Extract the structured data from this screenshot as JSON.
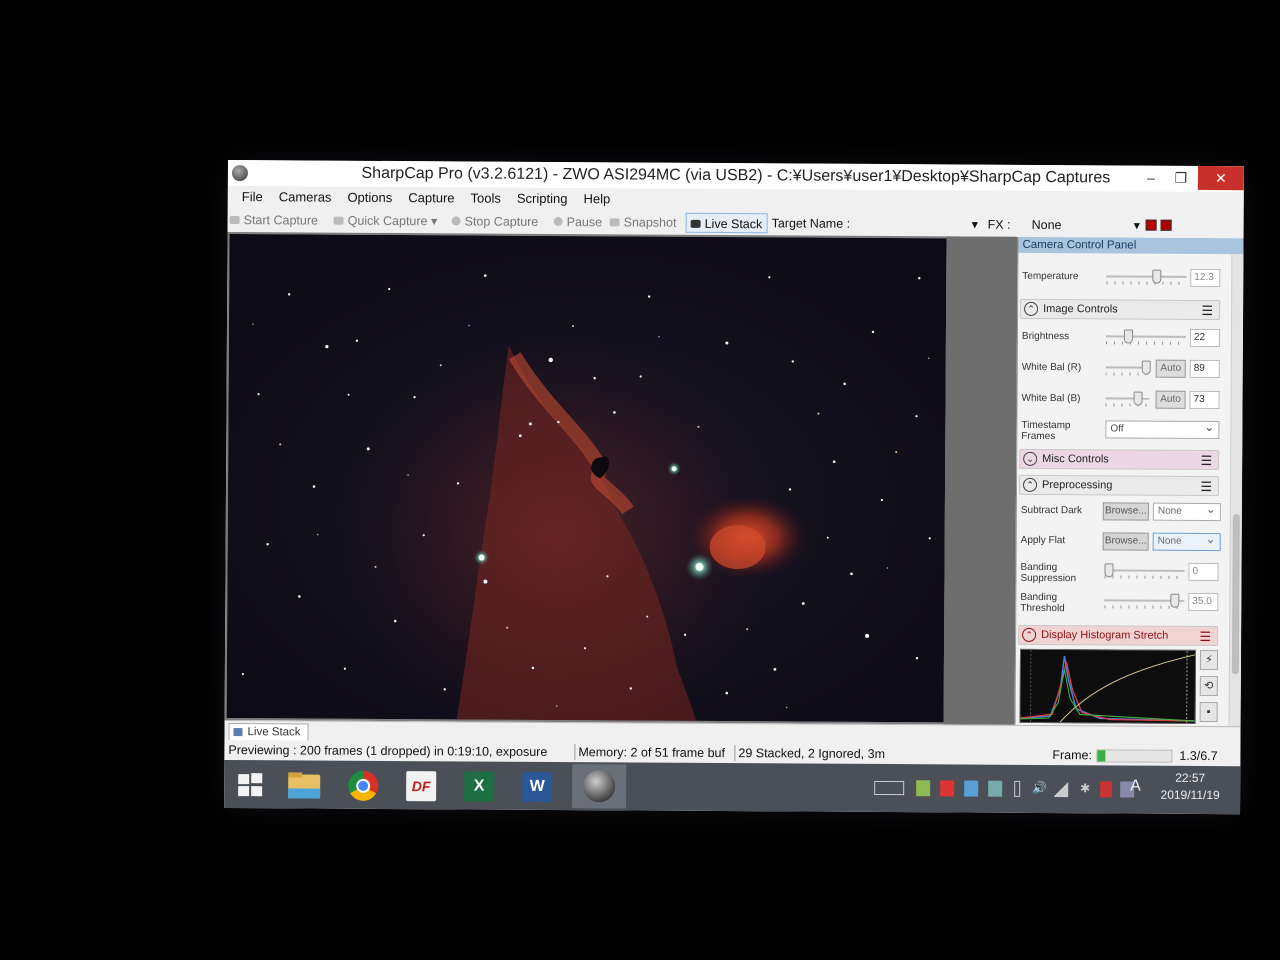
{
  "window": {
    "title": "SharpCap Pro (v3.2.6121) - ZWO ASI294MC (via USB2) - C:¥Users¥user1¥Desktop¥SharpCap Captures",
    "min": "–",
    "max": "❐",
    "close": "✕"
  },
  "menu": [
    "File",
    "Cameras",
    "Options",
    "Capture",
    "Tools",
    "Scripting",
    "Help"
  ],
  "toolbar": {
    "start_capture": "Start Capture",
    "quick_capture": "Quick Capture",
    "stop_capture": "Stop Capture",
    "pause": "Pause",
    "snapshot": "Snapshot",
    "live_stack": "Live Stack",
    "target_name": "Target Name :",
    "fx_label": "FX :",
    "fx_value": "None"
  },
  "panel": {
    "header": "Camera Control Panel",
    "temperature": {
      "label": "Temperature",
      "value": "12.3"
    },
    "image_controls": {
      "title": "Image Controls",
      "brightness": {
        "label": "Brightness",
        "value": "22"
      },
      "wb_r": {
        "label": "White Bal (R)",
        "auto": "Auto",
        "value": "89"
      },
      "wb_b": {
        "label": "White Bal (B)",
        "auto": "Auto",
        "value": "73"
      },
      "timestamp": {
        "label": "Timestamp Frames",
        "value": "Off"
      }
    },
    "misc_controls": {
      "title": "Misc Controls"
    },
    "preprocessing": {
      "title": "Preprocessing",
      "subtract_dark": {
        "label": "Subtract Dark",
        "browse": "Browse...",
        "value": "None"
      },
      "apply_flat": {
        "label": "Apply Flat",
        "browse": "Browse...",
        "value": "None"
      },
      "banding_suppression": {
        "label": "Banding Suppression",
        "value": "0"
      },
      "banding_threshold": {
        "label": "Banding Threshold",
        "value": "35.0"
      }
    },
    "histogram": {
      "title": "Display Histogram Stretch"
    }
  },
  "status": {
    "tab": "Live Stack",
    "previewing": "Previewing : 200 frames (1 dropped) in 0:19:10, exposure",
    "memory": "Memory: 2 of 51 frame buf",
    "stacked": "29 Stacked, 2 Ignored, 3m",
    "frame_label": "Frame:",
    "frame_progress": 0.11,
    "ratio": "1.3/6.7"
  },
  "taskbar": {
    "apps": [
      "windows-start",
      "file-explorer",
      "chrome",
      "df",
      "excel",
      "word",
      "sharpcap"
    ],
    "ime": "A",
    "time": "22:57",
    "date": "2019/11/19"
  },
  "colors": {
    "close_button": "#c7302b",
    "panel_header": "#a9c4de",
    "taskbar": "#4a4f58",
    "frame_progress": "#3cb043"
  }
}
